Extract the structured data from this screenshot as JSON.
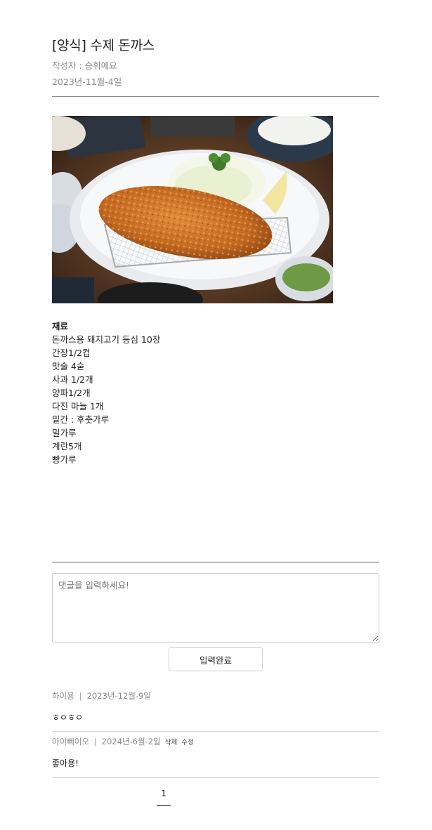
{
  "post": {
    "title": "[양식] 수제 돈까스",
    "author": "작성자 : 승휘에요",
    "date": "2023년-11월-4일"
  },
  "recipe": {
    "heading": "재료",
    "ingredients": [
      "돈까스용 돼지고기 등심 10장",
      "간장1/2컵",
      "맛술 4숟",
      "사과 1/2개",
      "양파1/2개",
      "다진 마늘 1개",
      "밑간 : 후춧가루",
      "밀가루",
      "계란5개",
      "빵가루"
    ]
  },
  "comment_form": {
    "placeholder": "댓글을 입력하세요!",
    "submit_label": "입력완료"
  },
  "comments": [
    {
      "author": "하이용",
      "separator": "|",
      "date": "2023년-12월-9일",
      "text": "ㅎㅇㅎㅇ"
    },
    {
      "author": "아이뻬이오",
      "separator": "|",
      "date": "2024년-6월-2일",
      "delete_label": "삭제",
      "edit_label": "수정",
      "text": "좋아용!"
    }
  ],
  "pagination": {
    "current": "1"
  },
  "colors": {
    "text": "#222222",
    "muted": "#888888",
    "rule": "#888888",
    "border": "#c9c9c9"
  }
}
